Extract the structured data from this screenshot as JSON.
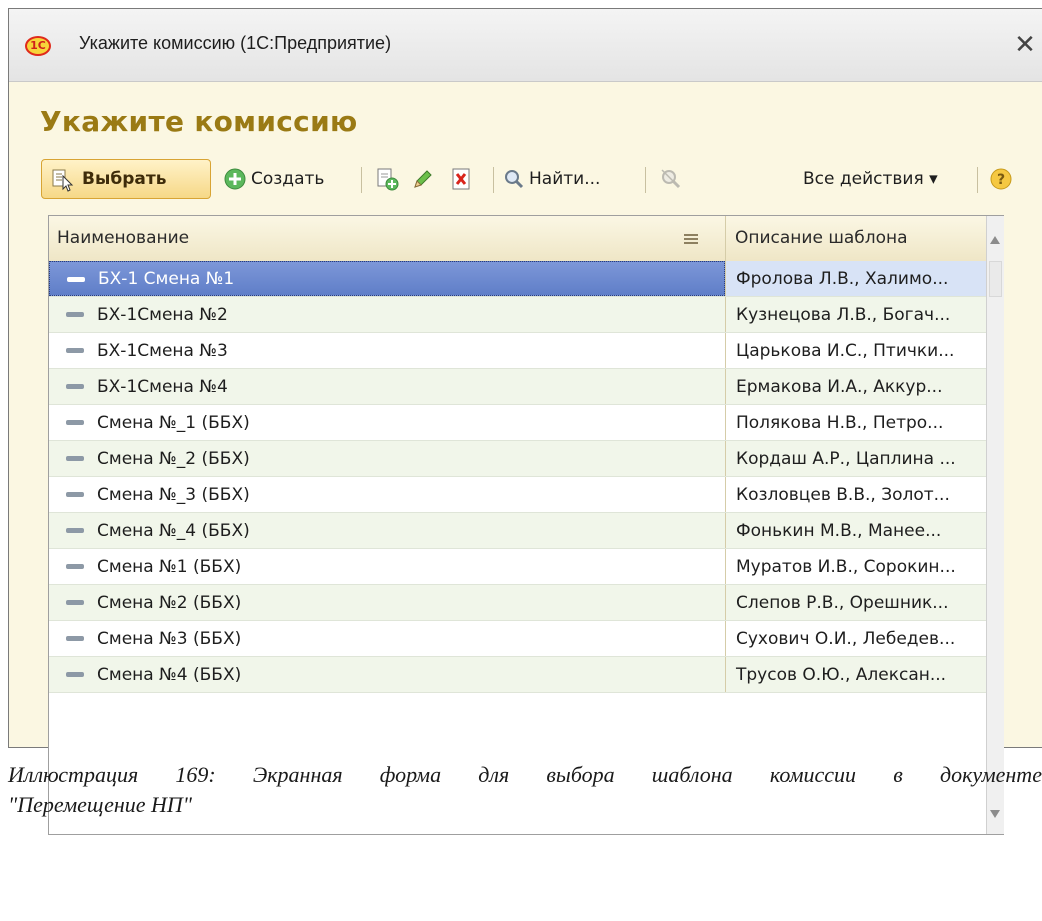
{
  "window": {
    "title": "Укажите комиссию  (1С:Предприятие)",
    "logo_text": "1С",
    "close_glyph": "✕"
  },
  "form": {
    "heading": "Укажите комиссию"
  },
  "toolbar": {
    "select_label": "Выбрать",
    "create_label": "Создать",
    "find_label": "Найти...",
    "all_actions_label": "Все действия ▾",
    "icons": [
      "select-icon",
      "create-icon",
      "copy-icon",
      "edit-icon",
      "delete-icon",
      "find-icon",
      "cancel-search-icon",
      "help-icon"
    ]
  },
  "grid": {
    "columns": [
      "Наименование",
      "Описание шаблона"
    ],
    "rows": [
      {
        "name": "БХ-1 Смена №1",
        "desc": "Фролова Л.В., Халимо..."
      },
      {
        "name": "БХ-1Смена №2",
        "desc": "Кузнецова Л.В., Богач..."
      },
      {
        "name": "БХ-1Смена №3",
        "desc": "Царькова И.С., Птички..."
      },
      {
        "name": "БХ-1Смена №4",
        "desc": "Ермакова И.А., Аккур..."
      },
      {
        "name": "Смена №_1 (ББХ)",
        "desc": "Полякова Н.В., Петро..."
      },
      {
        "name": "Смена №_2 (ББХ)",
        "desc": "Кордаш А.Р., Цаплина ..."
      },
      {
        "name": "Смена №_3 (ББХ)",
        "desc": "Козловцев В.В., Золот..."
      },
      {
        "name": "Смена №_4 (ББХ)",
        "desc": "Фонькин М.В., Манее..."
      },
      {
        "name": "Смена №1 (ББХ)",
        "desc": "Муратов И.В., Сорокин..."
      },
      {
        "name": "Смена №2 (ББХ)",
        "desc": "Слепов Р.В., Орешник..."
      },
      {
        "name": "Смена №3 (ББХ)",
        "desc": "Сухович О.И., Лебедев..."
      },
      {
        "name": "Смена №4 (ББХ)",
        "desc": "Трусов О.Ю., Алексан..."
      }
    ],
    "selected_index": 0
  },
  "caption": {
    "line1": [
      "Иллюстрация",
      "169:",
      "Экранная",
      "форма",
      "для",
      "выбора",
      "шаблона",
      "комиссии",
      "в",
      "документе"
    ],
    "line2": "\"Перемещение НП\""
  },
  "colors": {
    "heading": "#9a7a14",
    "selection": "#6b88d0",
    "background": "#fbf7e2"
  }
}
